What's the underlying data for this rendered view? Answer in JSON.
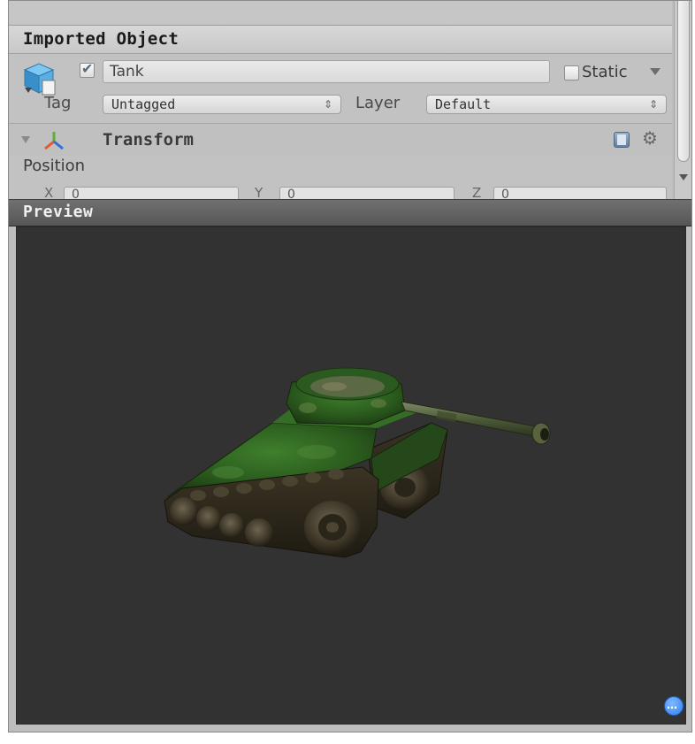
{
  "inspector": {
    "header_title": "Imported Object",
    "object_name": "Tank",
    "static_label": "Static",
    "tag_label": "Tag",
    "tag_value": "Untagged",
    "layer_label": "Layer",
    "layer_value": "Default",
    "transform_title": "Transform",
    "position_label": "Position",
    "position_axes": [
      "X",
      "Y",
      "Z"
    ],
    "position_values": [
      "0",
      "0",
      "0"
    ]
  },
  "preview": {
    "title": "Preview",
    "settings_glyph": "…"
  },
  "icons": {
    "object": "cube-prefab-icon",
    "transform": "transform-axes-icon",
    "help": "help-book-icon",
    "gear": "gear-icon",
    "settings": "preview-settings-icon"
  },
  "colors": {
    "preview_background": "#323232",
    "header_background": "#606060",
    "tank_green": "#2e6b22"
  }
}
